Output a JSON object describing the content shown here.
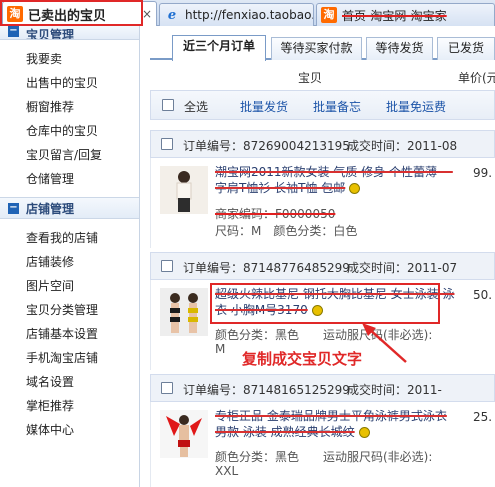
{
  "browser": {
    "tabs": [
      {
        "title": "已卖出的宝贝",
        "active": true,
        "icon": "taobao-icon"
      },
      {
        "title": "http://fenxiao.taobao....",
        "active": false,
        "icon": "ie-icon"
      },
      {
        "title": "首页-淘宝网-淘宝家",
        "active": false,
        "icon": "taobao-icon"
      }
    ],
    "close_glyph": "×"
  },
  "sidebar": {
    "section1": {
      "title": "宝贝管理",
      "items": [
        "我要卖",
        "出售中的宝贝",
        "橱窗推荐",
        "仓库中的宝贝",
        "宝贝留言/回复",
        "仓储管理"
      ]
    },
    "section2": {
      "title": "店铺管理",
      "items": [
        "查看我的店铺",
        "店铺装修",
        "图片空间",
        "宝贝分类管理",
        "店铺基本设置",
        "手机淘宝店铺",
        "域名设置",
        "掌柜推荐",
        "媒体中心"
      ]
    }
  },
  "order_tabs": [
    "近三个月订单",
    "等待买家付款",
    "等待发货",
    "已发货"
  ],
  "columns": {
    "item": "宝贝",
    "price": "单价(元"
  },
  "bulk": {
    "select_all": "全选",
    "ship": "批量发货",
    "memo": "批量备忘",
    "free_shipping": "批量免运费"
  },
  "orders": [
    {
      "number": "订单编号：87269004213195",
      "time": "成交时间：2011-08",
      "title": "潮宝网2011新款女装 气质 修身 个性蕾薄 一字肩T恤衫 长袖T恤 包邮",
      "merchant": "商家编码：F0000050",
      "spec": "尺码：M　颜色分类：白色",
      "price": "99."
    },
    {
      "number": "订单编号：87148776485299",
      "time": "成交时间：2011-07",
      "title": "超级火辣比基尼 钢托大胸比基尼 女士泳装 泳衣 小胸M号3170",
      "spec": "颜色分类：黑色　　运动服尺码(非必选):",
      "spec2": "M",
      "price": "50."
    },
    {
      "number": "订单编号：87148165125299",
      "time": "成交时间：2011-",
      "title": "专柜正品 金泰瑞品牌男士平角泳裤男式泳衣男款 泳装 成熟经典长城纹",
      "spec": "颜色分类：黑色　　运动服尺码(非必选):",
      "spec2": "XXL",
      "price": "25."
    }
  ],
  "annotation": "复制成交宝贝文字",
  "colors": {
    "highlight": "#e02828",
    "link": "#1c54a8",
    "accent": "#1f63b5"
  }
}
